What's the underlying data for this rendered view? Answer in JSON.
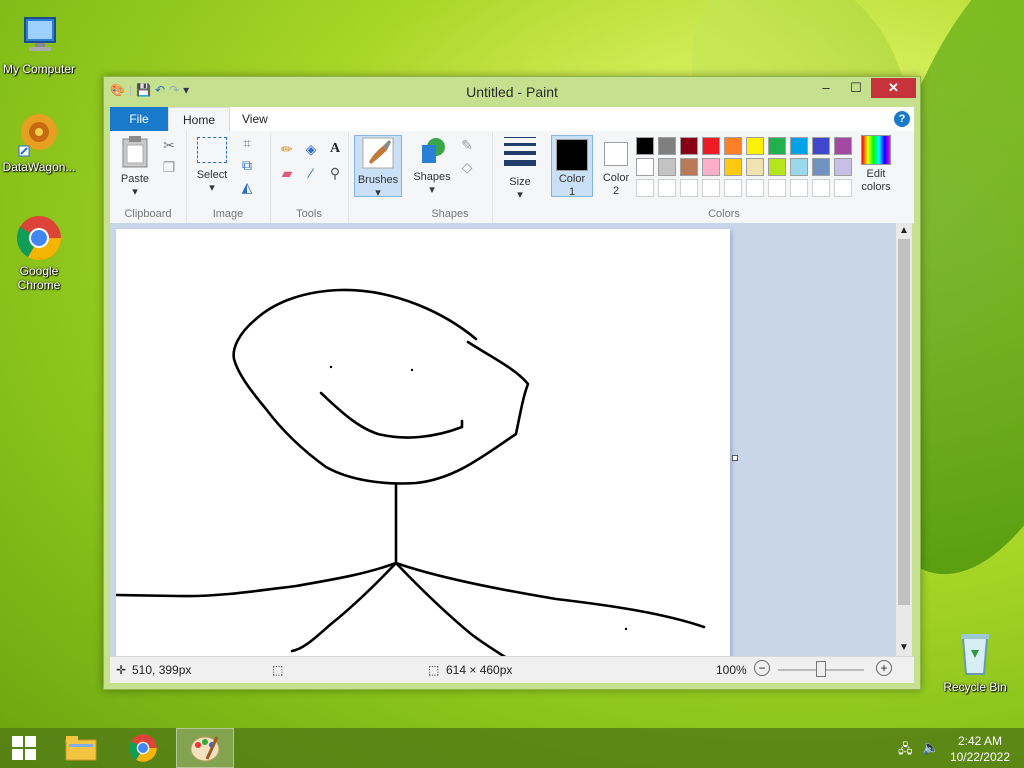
{
  "desktop": {
    "icons": [
      {
        "label": "My Computer"
      },
      {
        "label": "DataWagon..."
      },
      {
        "label": "Google Chrome"
      },
      {
        "label": "Recycle Bin"
      }
    ]
  },
  "window": {
    "title": "Untitled - Paint",
    "minimize": "–",
    "maximize": "☐",
    "close": "✕"
  },
  "tabs": {
    "file": "File",
    "home": "Home",
    "view": "View",
    "help": "?"
  },
  "ribbon": {
    "clipboard": {
      "label": "Clipboard",
      "paste": "Paste"
    },
    "image": {
      "label": "Image",
      "select": "Select"
    },
    "tools": {
      "label": "Tools"
    },
    "brushes": {
      "label": "Brushes"
    },
    "shapes": {
      "label": "Shapes",
      "button": "Shapes"
    },
    "size": {
      "label": "Size"
    },
    "colors": {
      "label": "Colors",
      "color1": "Color 1",
      "color2": "Color 2",
      "edit": "Edit colors",
      "color1_value": "#000000",
      "color2_value": "#ffffff",
      "row1": [
        "#000000",
        "#7f7f7f",
        "#880015",
        "#ed1c24",
        "#ff7f27",
        "#fff200",
        "#22b14c",
        "#00a2e8",
        "#3f48cc",
        "#a349a4"
      ],
      "row2": [
        "#ffffff",
        "#c3c3c3",
        "#b97a57",
        "#ffaec9",
        "#ffc90e",
        "#efe4b0",
        "#b5e61d",
        "#99d9ea",
        "#7092be",
        "#c8bfe7"
      ]
    }
  },
  "status": {
    "cursor": "510, 399px",
    "size": "614 × 460px",
    "zoom": "100%"
  },
  "taskbar": {
    "time": "2:42 AM",
    "date": "10/22/2022"
  }
}
